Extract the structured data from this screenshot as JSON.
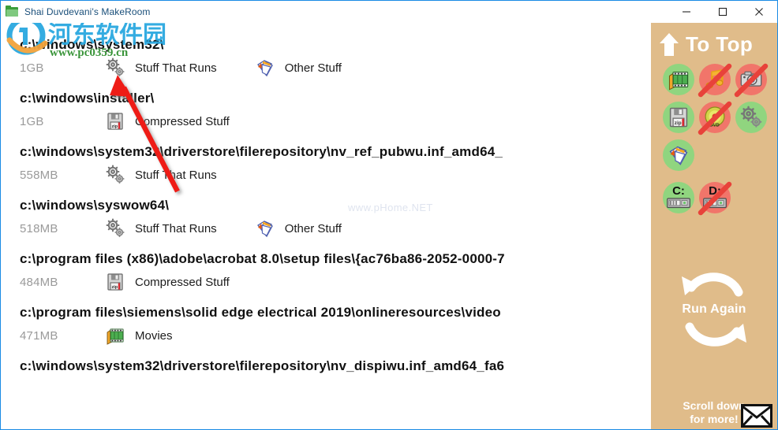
{
  "window": {
    "title": "Shai Duvdevani's MakeRoom",
    "icon": "folder-icon",
    "controls": {
      "minimize": "minimize-icon",
      "maximize": "maximize-icon",
      "close": "close-icon"
    }
  },
  "watermarks": {
    "logo_cn": "河东软件园",
    "logo_url": "www.pc0359.cn",
    "faint": "www.pHome.NET"
  },
  "results": [
    {
      "path": "c:\\windows\\system32\\",
      "size": "1GB",
      "categories": [
        {
          "icon": "gears-icon",
          "label": "Stuff That Runs"
        },
        {
          "icon": "notepad-icon",
          "label": "Other Stuff"
        }
      ]
    },
    {
      "path": "c:\\windows\\installer\\",
      "size": "1GB",
      "categories": [
        {
          "icon": "floppy-zip-icon",
          "label": "Compressed Stuff"
        }
      ]
    },
    {
      "path": "c:\\windows\\system32\\driverstore\\filerepository\\nv_ref_pubwu.inf_amd64_",
      "size": "558MB",
      "categories": [
        {
          "icon": "gears-icon",
          "label": "Stuff That Runs"
        }
      ]
    },
    {
      "path": "c:\\windows\\syswow64\\",
      "size": "518MB",
      "categories": [
        {
          "icon": "gears-icon",
          "label": "Stuff That Runs"
        },
        {
          "icon": "notepad-icon",
          "label": "Other Stuff"
        }
      ]
    },
    {
      "path": "c:\\program files (x86)\\adobe\\acrobat 8.0\\setup files\\{ac76ba86-2052-0000-7",
      "size": "484MB",
      "categories": [
        {
          "icon": "floppy-zip-icon",
          "label": "Compressed Stuff"
        }
      ]
    },
    {
      "path": "c:\\program files\\siemens\\solid edge electrical 2019\\onlineresources\\video",
      "size": "471MB",
      "categories": [
        {
          "icon": "film-icon",
          "label": "Movies"
        }
      ]
    },
    {
      "path": "c:\\windows\\system32\\driverstore\\filerepository\\nv_dispiwu.inf_amd64_fa6",
      "size": "",
      "categories": []
    }
  ],
  "sidebar": {
    "to_top": {
      "label": "To Top",
      "icon": "arrow-up-icon"
    },
    "filters": [
      {
        "name": "movies",
        "icon": "film-icon",
        "enabled": true
      },
      {
        "name": "music",
        "icon": "music-note-icon",
        "enabled": false
      },
      {
        "name": "pictures",
        "icon": "camera-icon",
        "enabled": false
      },
      {
        "name": "compressed",
        "icon": "floppy-zip-icon",
        "enabled": true
      },
      {
        "name": "discs",
        "icon": "dvd-icon",
        "enabled": false
      },
      {
        "name": "stuff-that-runs",
        "icon": "gears-icon",
        "enabled": true
      },
      {
        "name": "other-stuff",
        "icon": "notepad-icon",
        "enabled": true
      }
    ],
    "drives": [
      {
        "letter": "C:",
        "icon": "hard-drive-icon",
        "enabled": true
      },
      {
        "letter": "D:",
        "icon": "hard-drive-icon",
        "enabled": false
      }
    ],
    "run_again": {
      "label": "Run Again",
      "icon": "refresh-circular-arrows-icon"
    },
    "scroll_hint_line1": "Scroll down",
    "scroll_hint_line2": "for more!",
    "mail_icon": "envelope-icon"
  },
  "annotation": {
    "name": "red-arrow-annotation",
    "color": "#ee1b19"
  },
  "colors": {
    "sidebar_bg": "#e0bc8a",
    "window_border": "#1a8ae5",
    "title_text": "#1a4f7a",
    "path_text": "#111111",
    "size_text": "#9a9a9a",
    "filter_on": "#90d57f",
    "filter_off": "#f1756a"
  }
}
